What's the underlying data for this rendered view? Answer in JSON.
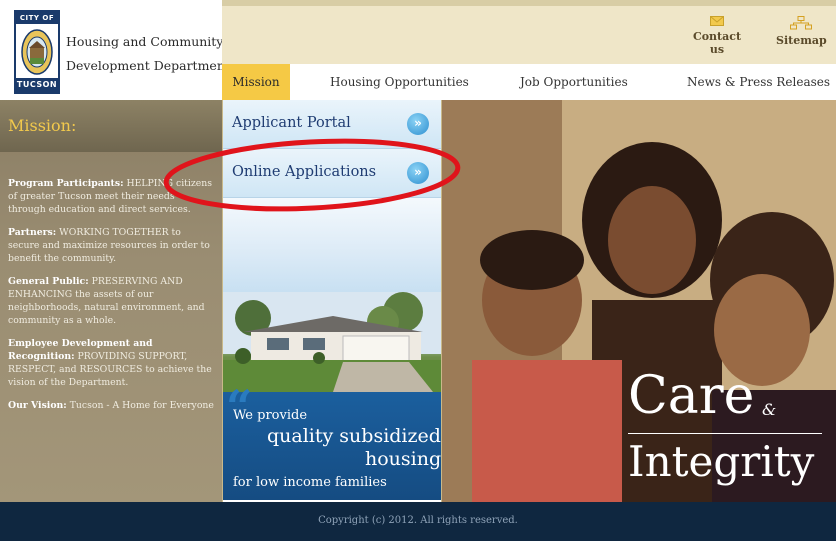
{
  "logo": {
    "top_text": "CITY OF",
    "bottom_text": "TUCSON"
  },
  "department": {
    "line1": "Housing and Community",
    "line2": "Development Department"
  },
  "utility": {
    "contact": "Contact us",
    "sitemap": "Sitemap"
  },
  "nav": {
    "items": [
      {
        "label": "Mission"
      },
      {
        "label": "Housing Opportunities"
      },
      {
        "label": "Job Opportunities"
      },
      {
        "label": "News & Press Releases"
      }
    ]
  },
  "mission": {
    "title": "Mission:",
    "paragraphs": [
      {
        "bold": "Program Participants:",
        "text": " HELPING citizens of greater Tucson meet their needs through education and direct services."
      },
      {
        "bold": "Partners:",
        "text": " WORKING TOGETHER to secure and maximize resources in order to benefit the community."
      },
      {
        "bold": "General Public:",
        "text": " PRESERVING AND ENHANCING the assets of our neighborhoods, natural environment, and community as a whole."
      },
      {
        "bold": "Employee Development and Recognition:",
        "text": " PROVIDING SUPPORT, RESPECT, and RESOURCES to achieve the vision of the Department."
      },
      {
        "bold": "Our Vision:",
        "text": " Tucson - A Home for Everyone"
      }
    ]
  },
  "menu": {
    "items": [
      {
        "label": "Applicant Portal",
        "arrow": "»"
      },
      {
        "label": "Online Applications",
        "arrow": "»"
      }
    ]
  },
  "promo": {
    "quote": "“",
    "line1": "We provide",
    "line2": "quality subsidized",
    "line3": "housing",
    "line4": "for low income families"
  },
  "hero": {
    "word1": "Care",
    "amp": "&",
    "word2": "Integrity"
  },
  "footer": {
    "copyright": "Copyright (c) 2012. All rights reserved."
  },
  "colors": {
    "annotation": "#e0141b",
    "nav_active": "#f5c945",
    "mission_title": "#f2c94c",
    "footer_bg": "#0f2740"
  }
}
